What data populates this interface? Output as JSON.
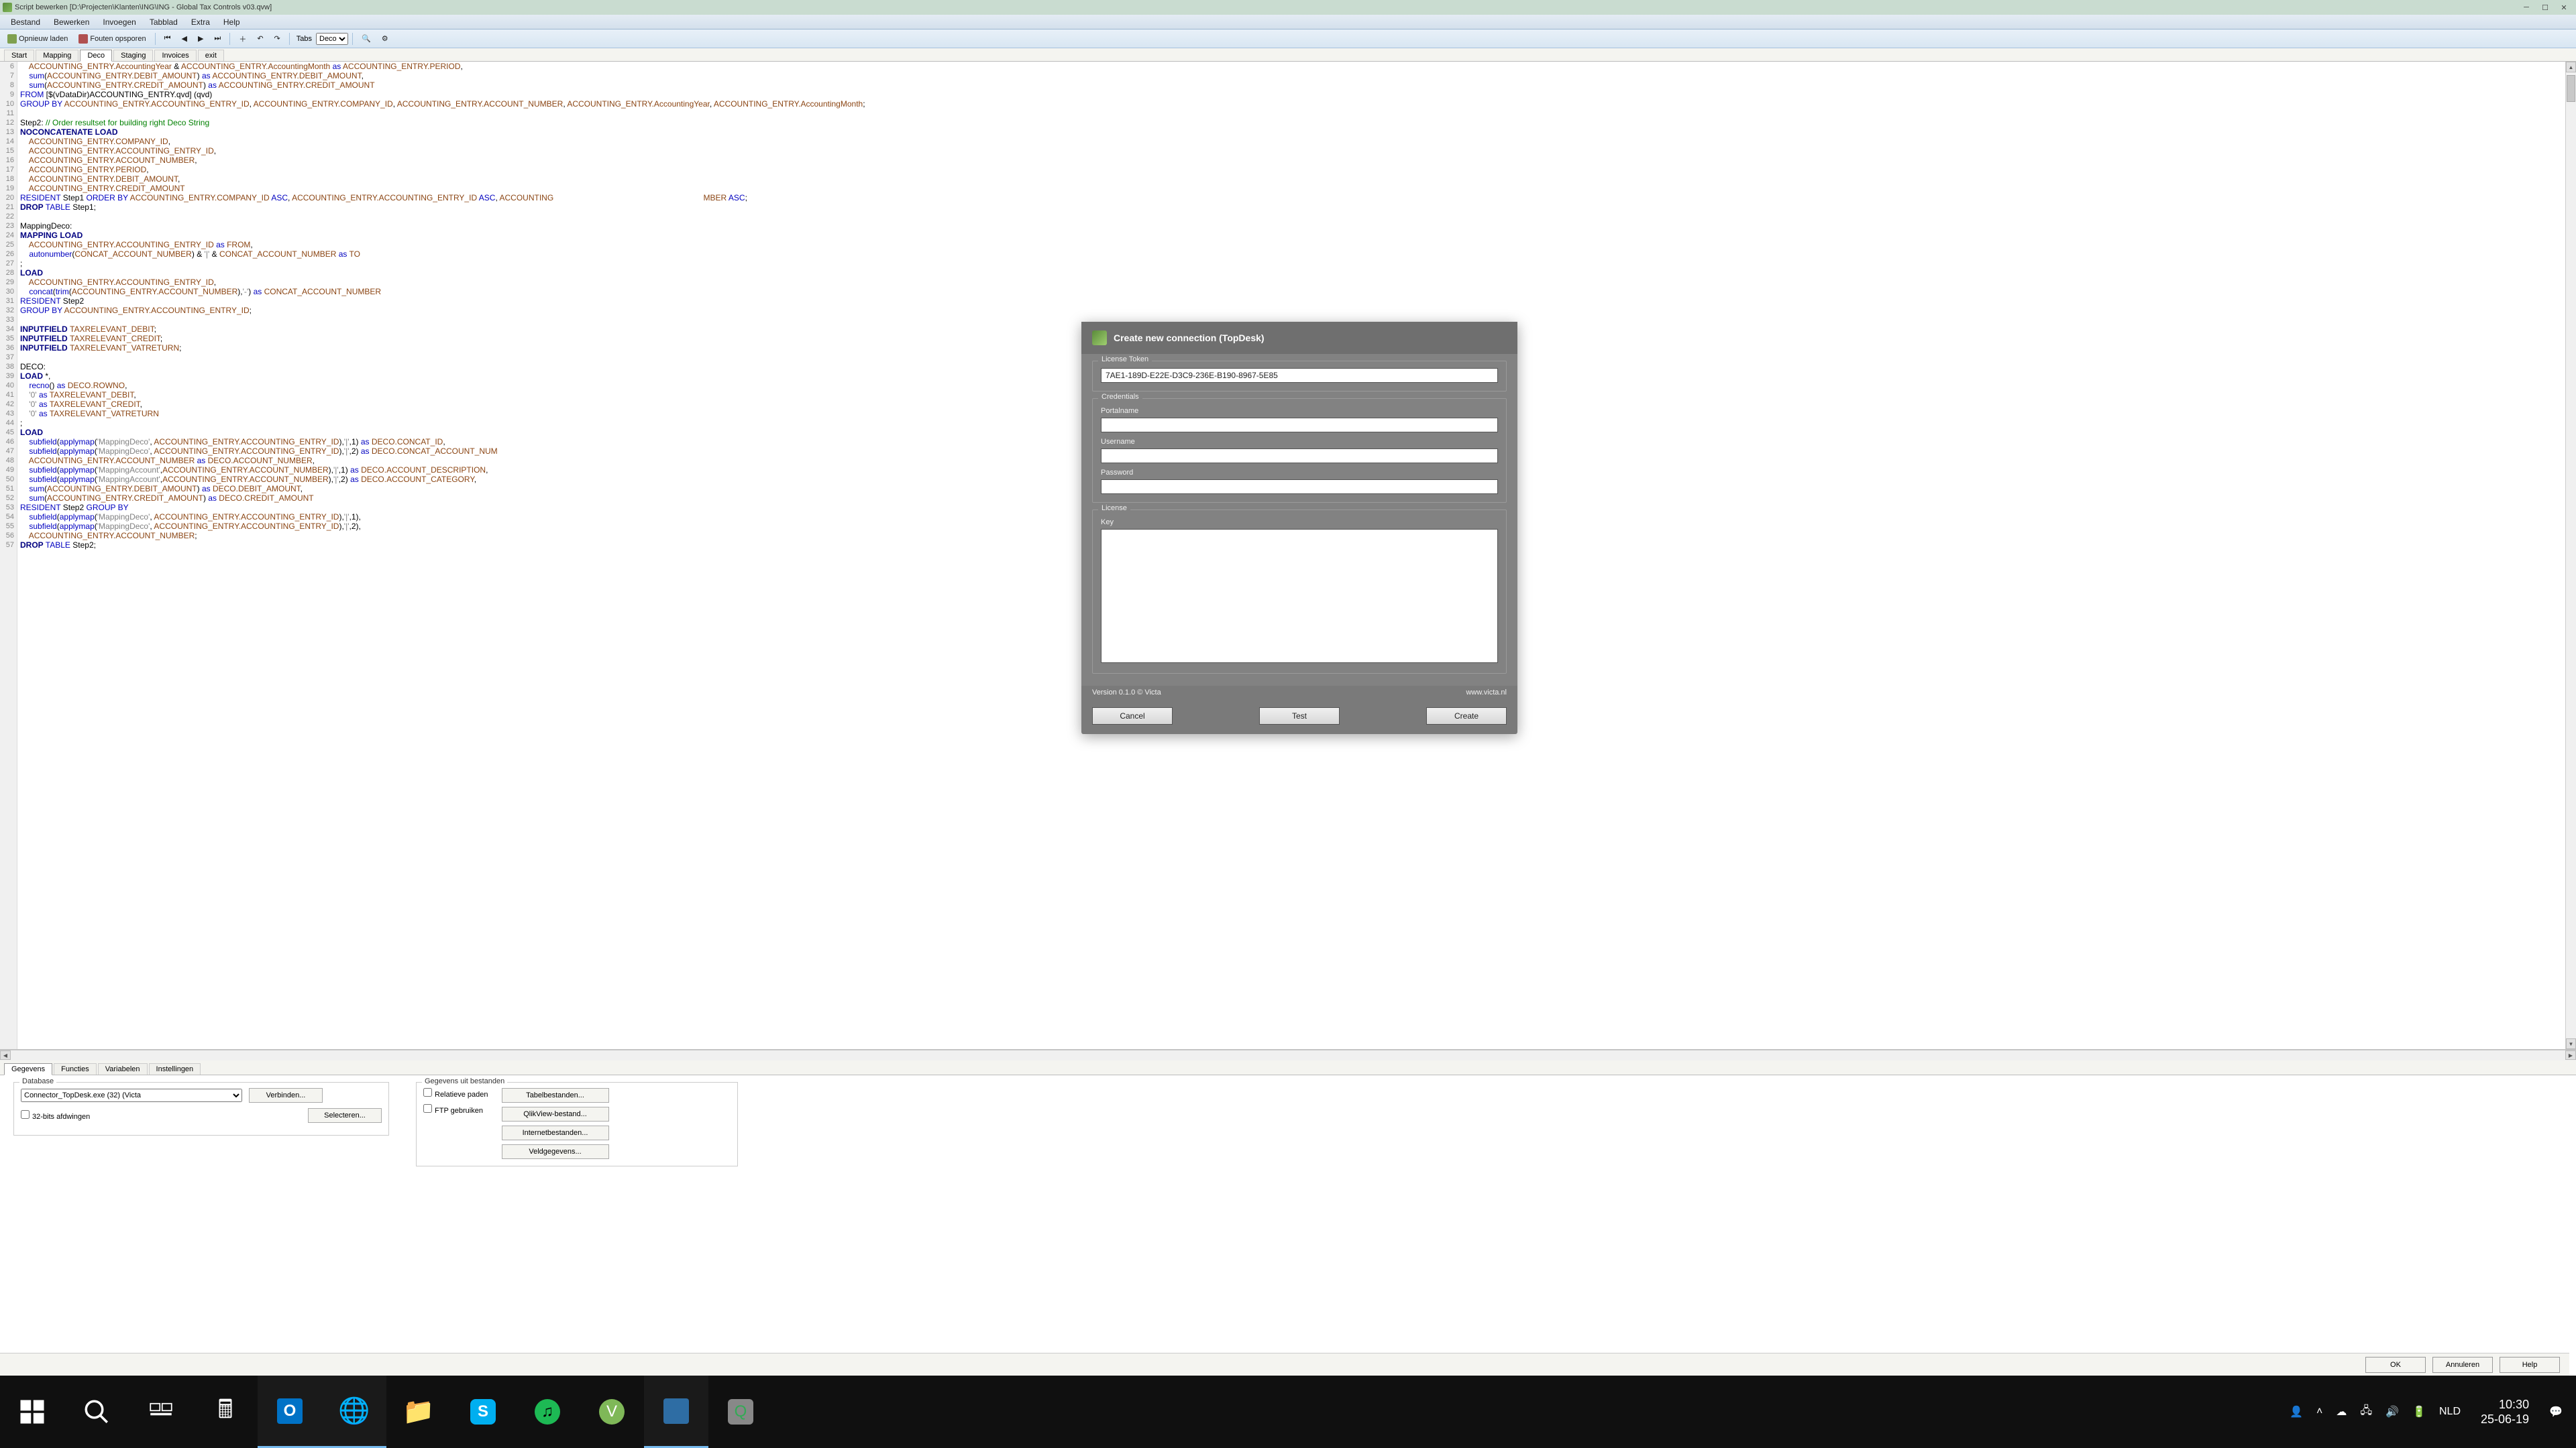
{
  "window": {
    "title": "Script bewerken [D:\\Projecten\\Klanten\\ING\\ING - Global Tax Controls v03.qvw]"
  },
  "menu": [
    "Bestand",
    "Bewerken",
    "Invoegen",
    "Tabblad",
    "Extra",
    "Help"
  ],
  "toolbar": {
    "reload": "Opnieuw laden",
    "debug": "Fouten opsporen",
    "tabs_label": "Tabs",
    "tabs_value": "Deco"
  },
  "script_tabs": [
    "Start",
    "Mapping",
    "Deco",
    "Staging",
    "Invoices",
    "exit"
  ],
  "script_active_tab": "Deco",
  "code_start_line": 6,
  "code_lines": [
    [
      [
        "    ",
        "pad"
      ],
      [
        "ACCOUNTING_ENTRY.AccountingYear ",
        "brown"
      ],
      [
        "& ",
        "black"
      ],
      [
        "ACCOUNTING_ENTRY.AccountingMonth ",
        "brown"
      ],
      [
        "as ",
        "blue"
      ],
      [
        "ACCOUNTING_ENTRY.PERIOD",
        "brown"
      ],
      [
        ",",
        "black"
      ]
    ],
    [
      [
        "    ",
        "pad"
      ],
      [
        "sum",
        "blue"
      ],
      [
        "(",
        "black"
      ],
      [
        "ACCOUNTING_ENTRY.DEBIT_AMOUNT",
        "brown"
      ],
      [
        ") ",
        "black"
      ],
      [
        "as ",
        "blue"
      ],
      [
        "ACCOUNTING_ENTRY.DEBIT_AMOUNT",
        "brown"
      ],
      [
        ",",
        "black"
      ]
    ],
    [
      [
        "    ",
        "pad"
      ],
      [
        "sum",
        "blue"
      ],
      [
        "(",
        "black"
      ],
      [
        "ACCOUNTING_ENTRY.CREDIT_AMOUNT",
        "brown"
      ],
      [
        ") ",
        "black"
      ],
      [
        "as ",
        "blue"
      ],
      [
        "ACCOUNTING_ENTRY.CREDIT_AMOUNT",
        "brown"
      ]
    ],
    [
      [
        "FROM ",
        "blue"
      ],
      [
        "[$(vDataDir)ACCOUNTING_ENTRY.qvd] (qvd)",
        "black"
      ]
    ],
    [
      [
        "GROUP BY ",
        "blue"
      ],
      [
        "ACCOUNTING_ENTRY.ACCOUNTING_ENTRY_ID",
        "brown"
      ],
      [
        ", ",
        "black"
      ],
      [
        "ACCOUNTING_ENTRY.COMPANY_ID",
        "brown"
      ],
      [
        ", ",
        "black"
      ],
      [
        "ACCOUNTING_ENTRY.ACCOUNT_NUMBER",
        "brown"
      ],
      [
        ", ",
        "black"
      ],
      [
        "ACCOUNTING_ENTRY.AccountingYear",
        "brown"
      ],
      [
        ", ",
        "black"
      ],
      [
        "ACCOUNTING_ENTRY.AccountingMonth",
        "brown"
      ],
      [
        ";",
        "black"
      ]
    ],
    [
      [
        "",
        "pad"
      ]
    ],
    [
      [
        "Step2: ",
        "black"
      ],
      [
        "// Order resultset for building right Deco String",
        "green"
      ]
    ],
    [
      [
        "NOCONCATENATE ",
        "navy"
      ],
      [
        "LOAD",
        "navy"
      ]
    ],
    [
      [
        "    ",
        "pad"
      ],
      [
        "ACCOUNTING_ENTRY.COMPANY_ID",
        "brown"
      ],
      [
        ",",
        "black"
      ]
    ],
    [
      [
        "    ",
        "pad"
      ],
      [
        "ACCOUNTING_ENTRY.ACCOUNTING_ENTRY_ID",
        "brown"
      ],
      [
        ",",
        "black"
      ]
    ],
    [
      [
        "    ",
        "pad"
      ],
      [
        "ACCOUNTING_ENTRY.ACCOUNT_NUMBER",
        "brown"
      ],
      [
        ",",
        "black"
      ]
    ],
    [
      [
        "    ",
        "pad"
      ],
      [
        "ACCOUNTING_ENTRY.PERIOD",
        "brown"
      ],
      [
        ",",
        "black"
      ]
    ],
    [
      [
        "    ",
        "pad"
      ],
      [
        "ACCOUNTING_ENTRY.DEBIT_AMOUNT",
        "brown"
      ],
      [
        ",",
        "black"
      ]
    ],
    [
      [
        "    ",
        "pad"
      ],
      [
        "ACCOUNTING_ENTRY.CREDIT_AMOUNT",
        "brown"
      ]
    ],
    [
      [
        "RESIDENT ",
        "blue"
      ],
      [
        "Step1 ",
        "black"
      ],
      [
        "ORDER BY ",
        "blue"
      ],
      [
        "ACCOUNTING_ENTRY.COMPANY_ID ",
        "brown"
      ],
      [
        "ASC",
        "blue"
      ],
      [
        ", ",
        "black"
      ],
      [
        "ACCOUNTING_ENTRY.ACCOUNTING_ENTRY_ID ",
        "brown"
      ],
      [
        "ASC",
        "blue"
      ],
      [
        ", ",
        "black"
      ],
      [
        "ACCOUNTING                                                                   MBER ",
        "brown"
      ],
      [
        "ASC",
        "blue"
      ],
      [
        ";",
        "black"
      ]
    ],
    [
      [
        "DROP ",
        "navy"
      ],
      [
        "TABLE ",
        "blue"
      ],
      [
        "Step1;",
        "black"
      ]
    ],
    [
      [
        "",
        "pad"
      ]
    ],
    [
      [
        "MappingDeco:",
        "black"
      ]
    ],
    [
      [
        "MAPPING ",
        "navy"
      ],
      [
        "LOAD",
        "navy"
      ]
    ],
    [
      [
        "    ",
        "pad"
      ],
      [
        "ACCOUNTING_ENTRY.ACCOUNTING_ENTRY_ID ",
        "brown"
      ],
      [
        "as ",
        "blue"
      ],
      [
        "FROM",
        "brown"
      ],
      [
        ",",
        "black"
      ]
    ],
    [
      [
        "    ",
        "pad"
      ],
      [
        "autonumber",
        "blue"
      ],
      [
        "(",
        "black"
      ],
      [
        "CONCAT_ACCOUNT_NUMBER",
        "brown"
      ],
      [
        ") ",
        "black"
      ],
      [
        "& ",
        "black"
      ],
      [
        "'|' ",
        "str"
      ],
      [
        "& ",
        "black"
      ],
      [
        "CONCAT_ACCOUNT_NUMBER ",
        "brown"
      ],
      [
        "as ",
        "blue"
      ],
      [
        "TO",
        "brown"
      ]
    ],
    [
      [
        ";",
        "black"
      ]
    ],
    [
      [
        "LOAD",
        "navy"
      ]
    ],
    [
      [
        "    ",
        "pad"
      ],
      [
        "ACCOUNTING_ENTRY.ACCOUNTING_ENTRY_ID",
        "brown"
      ],
      [
        ",",
        "black"
      ]
    ],
    [
      [
        "    ",
        "pad"
      ],
      [
        "concat",
        "blue"
      ],
      [
        "(",
        "black"
      ],
      [
        "trim",
        "blue"
      ],
      [
        "(",
        "black"
      ],
      [
        "ACCOUNTING_ENTRY.ACCOUNT_NUMBER",
        "brown"
      ],
      [
        "),",
        "black"
      ],
      [
        "'-'",
        "str"
      ],
      [
        ") ",
        "black"
      ],
      [
        "as ",
        "blue"
      ],
      [
        "CONCAT_ACCOUNT_NUMBER",
        "brown"
      ]
    ],
    [
      [
        "RESIDENT ",
        "blue"
      ],
      [
        "Step2",
        "black"
      ]
    ],
    [
      [
        "GROUP BY ",
        "blue"
      ],
      [
        "ACCOUNTING_ENTRY.ACCOUNTING_ENTRY_ID",
        "brown"
      ],
      [
        ";",
        "black"
      ]
    ],
    [
      [
        "",
        "pad"
      ]
    ],
    [
      [
        "INPUTFIELD ",
        "navy"
      ],
      [
        "TAXRELEVANT_DEBIT",
        "brown"
      ],
      [
        ";",
        "black"
      ]
    ],
    [
      [
        "INPUTFIELD ",
        "navy"
      ],
      [
        "TAXRELEVANT_CREDIT",
        "brown"
      ],
      [
        ";",
        "black"
      ]
    ],
    [
      [
        "INPUTFIELD ",
        "navy"
      ],
      [
        "TAXRELEVANT_VATRETURN",
        "brown"
      ],
      [
        ";",
        "black"
      ]
    ],
    [
      [
        "",
        "pad"
      ]
    ],
    [
      [
        "DECO:",
        "black"
      ]
    ],
    [
      [
        "LOAD ",
        "navy"
      ],
      [
        "*,",
        "black"
      ]
    ],
    [
      [
        "    ",
        "pad"
      ],
      [
        "recno",
        "blue"
      ],
      [
        "() ",
        "black"
      ],
      [
        "as ",
        "blue"
      ],
      [
        "DECO.ROWNO",
        "brown"
      ],
      [
        ",",
        "black"
      ]
    ],
    [
      [
        "    ",
        "pad"
      ],
      [
        "'0' ",
        "str"
      ],
      [
        "as ",
        "blue"
      ],
      [
        "TAXRELEVANT_DEBIT",
        "brown"
      ],
      [
        ",",
        "black"
      ]
    ],
    [
      [
        "    ",
        "pad"
      ],
      [
        "'0' ",
        "str"
      ],
      [
        "as ",
        "blue"
      ],
      [
        "TAXRELEVANT_CREDIT",
        "brown"
      ],
      [
        ",",
        "black"
      ]
    ],
    [
      [
        "    ",
        "pad"
      ],
      [
        "'0' ",
        "str"
      ],
      [
        "as ",
        "blue"
      ],
      [
        "TAXRELEVANT_VATRETURN",
        "brown"
      ]
    ],
    [
      [
        ";",
        "black"
      ]
    ],
    [
      [
        "LOAD",
        "navy"
      ]
    ],
    [
      [
        "    ",
        "pad"
      ],
      [
        "subfield",
        "blue"
      ],
      [
        "(",
        "black"
      ],
      [
        "applymap",
        "blue"
      ],
      [
        "(",
        "black"
      ],
      [
        "'MappingDeco'",
        "str"
      ],
      [
        ", ",
        "black"
      ],
      [
        "ACCOUNTING_ENTRY.ACCOUNTING_ENTRY_ID",
        "brown"
      ],
      [
        "),",
        "black"
      ],
      [
        "'|'",
        "str"
      ],
      [
        ",1) ",
        "black"
      ],
      [
        "as ",
        "blue"
      ],
      [
        "DECO.CONCAT_ID",
        "brown"
      ],
      [
        ",",
        "black"
      ]
    ],
    [
      [
        "    ",
        "pad"
      ],
      [
        "subfield",
        "blue"
      ],
      [
        "(",
        "black"
      ],
      [
        "applymap",
        "blue"
      ],
      [
        "(",
        "black"
      ],
      [
        "'MappingDeco'",
        "str"
      ],
      [
        ", ",
        "black"
      ],
      [
        "ACCOUNTING_ENTRY.ACCOUNTING_ENTRY_ID",
        "brown"
      ],
      [
        "),",
        "black"
      ],
      [
        "'|'",
        "str"
      ],
      [
        ",2) ",
        "black"
      ],
      [
        "as ",
        "blue"
      ],
      [
        "DECO.CONCAT_ACCOUNT_NUM",
        "brown"
      ]
    ],
    [
      [
        "    ",
        "pad"
      ],
      [
        "ACCOUNTING_ENTRY.ACCOUNT_NUMBER ",
        "brown"
      ],
      [
        "as ",
        "blue"
      ],
      [
        "DECO.ACCOUNT_NUMBER",
        "brown"
      ],
      [
        ",",
        "black"
      ]
    ],
    [
      [
        "    ",
        "pad"
      ],
      [
        "subfield",
        "blue"
      ],
      [
        "(",
        "black"
      ],
      [
        "applymap",
        "blue"
      ],
      [
        "(",
        "black"
      ],
      [
        "'MappingAccount'",
        "str"
      ],
      [
        ",",
        "black"
      ],
      [
        "ACCOUNTING_ENTRY.ACCOUNT_NUMBER",
        "brown"
      ],
      [
        "),",
        "black"
      ],
      [
        "'|'",
        "str"
      ],
      [
        ",1) ",
        "black"
      ],
      [
        "as ",
        "blue"
      ],
      [
        "DECO.ACCOUNT_DESCRIPTION",
        "brown"
      ],
      [
        ",",
        "black"
      ]
    ],
    [
      [
        "    ",
        "pad"
      ],
      [
        "subfield",
        "blue"
      ],
      [
        "(",
        "black"
      ],
      [
        "applymap",
        "blue"
      ],
      [
        "(",
        "black"
      ],
      [
        "'MappingAccount'",
        "str"
      ],
      [
        ",",
        "black"
      ],
      [
        "ACCOUNTING_ENTRY.ACCOUNT_NUMBER",
        "brown"
      ],
      [
        "),",
        "black"
      ],
      [
        "'|'",
        "str"
      ],
      [
        ",2) ",
        "black"
      ],
      [
        "as ",
        "blue"
      ],
      [
        "DECO.ACCOUNT_CATEGORY",
        "brown"
      ],
      [
        ",",
        "black"
      ]
    ],
    [
      [
        "    ",
        "pad"
      ],
      [
        "sum",
        "blue"
      ],
      [
        "(",
        "black"
      ],
      [
        "ACCOUNTING_ENTRY.DEBIT_AMOUNT",
        "brown"
      ],
      [
        ") ",
        "black"
      ],
      [
        "as ",
        "blue"
      ],
      [
        "DECO.DEBIT_AMOUNT",
        "brown"
      ],
      [
        ",",
        "black"
      ]
    ],
    [
      [
        "    ",
        "pad"
      ],
      [
        "sum",
        "blue"
      ],
      [
        "(",
        "black"
      ],
      [
        "ACCOUNTING_ENTRY.CREDIT_AMOUNT",
        "brown"
      ],
      [
        ") ",
        "black"
      ],
      [
        "as ",
        "blue"
      ],
      [
        "DECO.CREDIT_AMOUNT",
        "brown"
      ]
    ],
    [
      [
        "RESIDENT ",
        "blue"
      ],
      [
        "Step2 ",
        "black"
      ],
      [
        "GROUP BY",
        "blue"
      ]
    ],
    [
      [
        "    ",
        "pad"
      ],
      [
        "subfield",
        "blue"
      ],
      [
        "(",
        "black"
      ],
      [
        "applymap",
        "blue"
      ],
      [
        "(",
        "black"
      ],
      [
        "'MappingDeco'",
        "str"
      ],
      [
        ", ",
        "black"
      ],
      [
        "ACCOUNTING_ENTRY.ACCOUNTING_ENTRY_ID",
        "brown"
      ],
      [
        "),",
        "black"
      ],
      [
        "'|'",
        "str"
      ],
      [
        ",1),",
        "black"
      ]
    ],
    [
      [
        "    ",
        "pad"
      ],
      [
        "subfield",
        "blue"
      ],
      [
        "(",
        "black"
      ],
      [
        "applymap",
        "blue"
      ],
      [
        "(",
        "black"
      ],
      [
        "'MappingDeco'",
        "str"
      ],
      [
        ", ",
        "black"
      ],
      [
        "ACCOUNTING_ENTRY.ACCOUNTING_ENTRY_ID",
        "brown"
      ],
      [
        "),",
        "black"
      ],
      [
        "'|'",
        "str"
      ],
      [
        ",2),",
        "black"
      ]
    ],
    [
      [
        "    ",
        "pad"
      ],
      [
        "ACCOUNTING_ENTRY.ACCOUNT_NUMBER",
        "brown"
      ],
      [
        ";",
        "black"
      ]
    ],
    [
      [
        "DROP ",
        "navy"
      ],
      [
        "TABLE ",
        "blue"
      ],
      [
        "Step2;",
        "black"
      ]
    ]
  ],
  "bottom_tabs": [
    "Gegevens",
    "Functies",
    "Variabelen",
    "Instellingen"
  ],
  "bottom_active_tab": "Gegevens",
  "bottom_panel": {
    "database_legend": "Database",
    "connector_value": "Connector_TopDesk.exe (32) (Victa",
    "connect_btn": "Verbinden...",
    "select_btn": "Selecteren...",
    "force32": "32-bits afdwingen",
    "files_legend": "Gegevens uit bestanden",
    "relative_paths": "Relatieve paden",
    "use_ftp": "FTP gebruiken",
    "table_files_btn": "Tabelbestanden...",
    "qlikview_file_btn": "QlikView-bestand...",
    "internet_files_btn": "Internetbestanden...",
    "field_data_btn": "Veldgegevens..."
  },
  "footer_buttons": {
    "ok": "OK",
    "cancel": "Annuleren",
    "help": "Help"
  },
  "modal": {
    "title": "Create new connection (TopDesk)",
    "license_token_legend": "License Token",
    "license_token_value": "7AE1-189D-E22E-D3C9-236E-B190-8967-5E85",
    "credentials_legend": "Credentials",
    "portalname_label": "Portalname",
    "username_label": "Username",
    "password_label": "Password",
    "license_legend": "License",
    "key_label": "Key",
    "version": "Version 0.1.0 © Victa",
    "url": "www.victa.nl",
    "cancel": "Cancel",
    "test": "Test",
    "create": "Create"
  },
  "taskbar": {
    "lang": "NLD",
    "time": "10:30",
    "date": "25-06-19"
  }
}
